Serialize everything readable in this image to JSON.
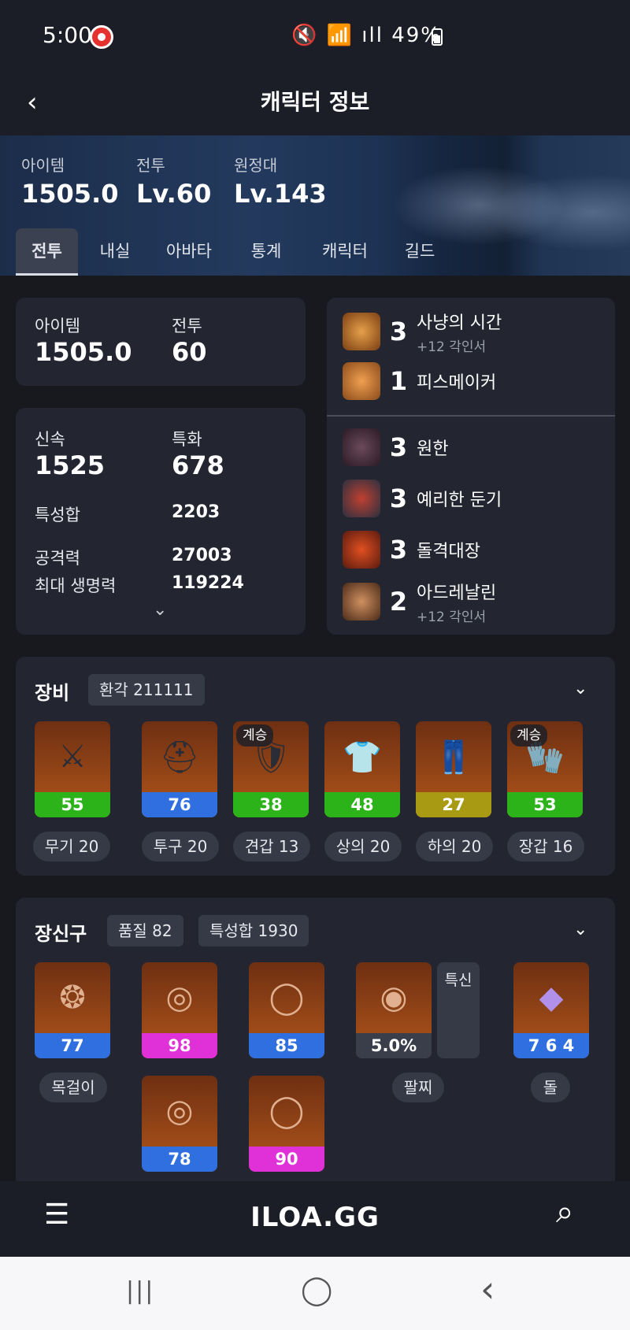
{
  "status_bar": {
    "time": "5:00",
    "icons": "🔇 📶 ıll",
    "battery": "49%"
  },
  "header": {
    "back": "‹",
    "title": "캐릭터 정보"
  },
  "hero": {
    "stats": [
      {
        "label": "아이템",
        "value": "1505.0"
      },
      {
        "label": "전투",
        "value": "Lv.60"
      },
      {
        "label": "원정대",
        "value": "Lv.143"
      }
    ]
  },
  "tabs": [
    "전투",
    "내실",
    "아바타",
    "통계",
    "캐릭터",
    "길드"
  ],
  "summary": {
    "item_label": "아이템",
    "item_value": "1505.0",
    "combat_label": "전투",
    "combat_value": "60"
  },
  "stats": {
    "swift_label": "신속",
    "swift_value": "1525",
    "spec_label": "특화",
    "spec_value": "678",
    "sum_label": "특성합",
    "sum_value": "2203",
    "atk_label": "공격력",
    "atk_value": "27003",
    "hp_label": "최대 생명력",
    "hp_value": "119224",
    "expand": "⌄"
  },
  "engravings_top": [
    {
      "level": "3",
      "name": "사냥의 시간",
      "sub": "+12 각인서"
    },
    {
      "level": "1",
      "name": "피스메이커",
      "sub": ""
    }
  ],
  "engravings_bottom": [
    {
      "level": "3",
      "name": "원한",
      "sub": ""
    },
    {
      "level": "3",
      "name": "예리한 둔기",
      "sub": ""
    },
    {
      "level": "3",
      "name": "돌격대장",
      "sub": ""
    },
    {
      "level": "2",
      "name": "아드레날린",
      "sub": "+12 각인서"
    }
  ],
  "equipment": {
    "title": "장비",
    "pill": "환각 211111",
    "chevron": "⌄",
    "items": [
      {
        "quality": "55",
        "color": "#2cb31a",
        "tag": "",
        "label": "무기 20"
      },
      {
        "quality": "76",
        "color": "#2f6fe0",
        "tag": "",
        "label": "투구 20"
      },
      {
        "quality": "38",
        "color": "#2cb31a",
        "tag": "계승",
        "label": "견갑 13"
      },
      {
        "quality": "48",
        "color": "#2cb31a",
        "tag": "",
        "label": "상의 20"
      },
      {
        "quality": "27",
        "color": "#a89a12",
        "tag": "",
        "label": "하의 20"
      },
      {
        "quality": "53",
        "color": "#2cb31a",
        "tag": "계승",
        "label": "장갑 16"
      }
    ]
  },
  "accessories": {
    "title": "장신구",
    "pill1": "품질 82",
    "pill2": "특성합 1930",
    "chevron": "⌄",
    "items": [
      {
        "quality": "77",
        "color": "#2f6fe0"
      },
      {
        "quality": "98",
        "color": "#e030d8"
      },
      {
        "quality": "85",
        "color": "#2f6fe0"
      },
      {
        "quality": "5.0%",
        "color": "#3a3e4a"
      },
      {
        "quality": "7 6 4",
        "color": "#2f6fe0"
      },
      {
        "quality": "78",
        "color": "#2f6fe0"
      },
      {
        "quality": "90",
        "color": "#e030d8"
      }
    ],
    "bracelet_tag": "특신",
    "labels": {
      "necklace": "목걸이",
      "bracelet": "팔찌",
      "stone": "돌"
    }
  },
  "bottom_nav": {
    "menu": "☰",
    "logo": "ILOA.GG",
    "search": "⌕"
  },
  "system_nav": {
    "recents": "|||",
    "home": "◯",
    "back": "‹"
  }
}
